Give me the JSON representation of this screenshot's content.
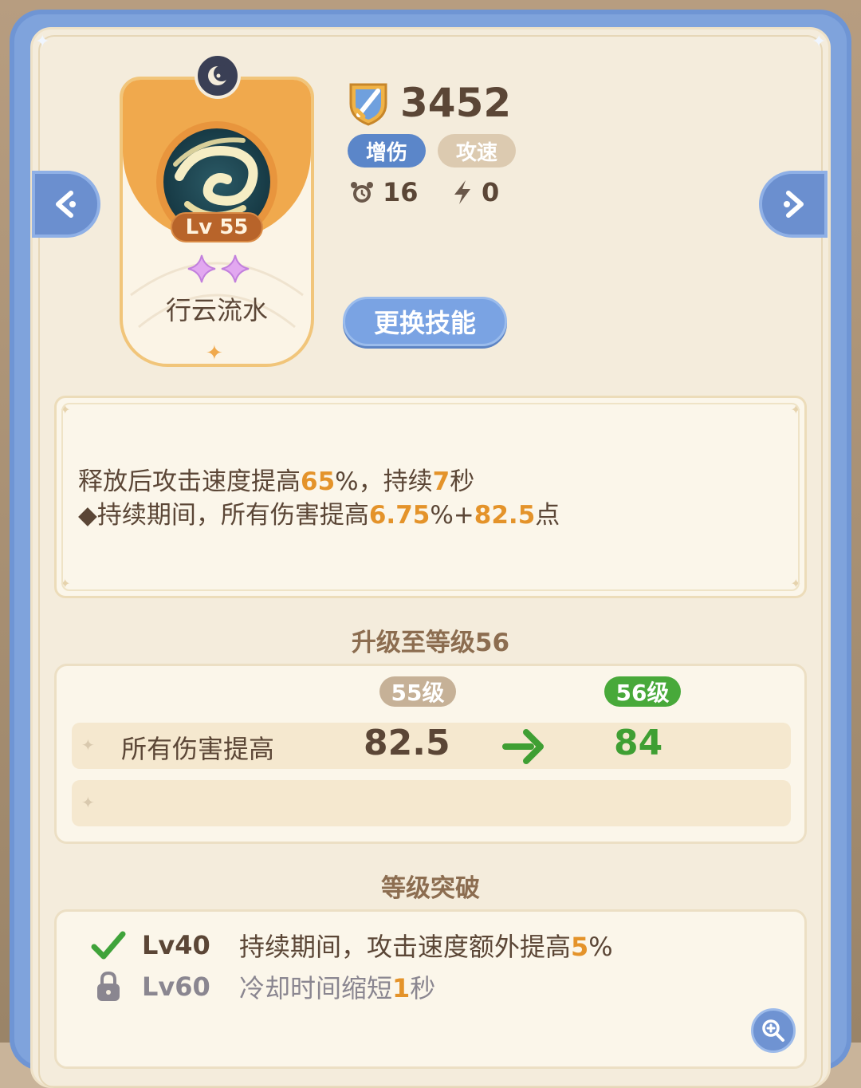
{
  "skill": {
    "level_badge": "Lv 55",
    "name": "行云流水",
    "star_count": 2
  },
  "power": {
    "value": "3452",
    "icon": "shield-sword-icon"
  },
  "tags": [
    "增伤",
    "攻速"
  ],
  "stats": {
    "cooldown": "16",
    "energy": "0"
  },
  "buttons": {
    "change_skill": "更换技能"
  },
  "description": {
    "line1": {
      "p1": "释放后攻击速度提高",
      "v1": "65",
      "p2": "%，持续",
      "v2": "7",
      "p3": "秒"
    },
    "line2": {
      "p1": "◆持续期间，所有伤害提高",
      "v1": "6.75",
      "p2": "%+",
      "v2": "82.5",
      "p3": "点"
    }
  },
  "upgrade": {
    "title": "升级至等级56",
    "current_level": "55级",
    "next_level": "56级",
    "stat_label": "所有伤害提高",
    "current_value": "82.5",
    "next_value": "84"
  },
  "breakthrough": {
    "title": "等级突破",
    "items": [
      {
        "level": "Lv40",
        "text": "持续期间，攻击速度额外提高",
        "highlight": "5",
        "suffix": "%",
        "status": "unlocked"
      },
      {
        "level": "Lv60",
        "text": "冷却时间缩短",
        "highlight": "1",
        "suffix": "秒",
        "status": "locked"
      }
    ]
  },
  "colors": {
    "frame_blue": "#7fa3dc",
    "panel": "#f4ecdc",
    "highlight_orange": "#e4932a",
    "next_green": "#3f9f33",
    "text_brown": "#5b4636"
  }
}
